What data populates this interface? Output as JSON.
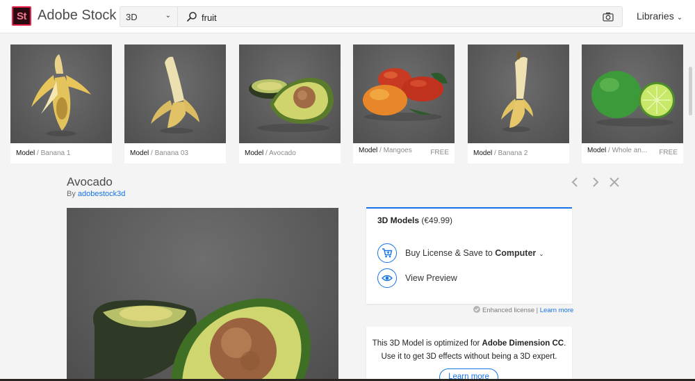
{
  "header": {
    "logo_text": "St",
    "brand": "Adobe Stock",
    "asset_type": "3D",
    "search_query": "fruit",
    "libraries_label": "Libraries"
  },
  "thumbnails": [
    {
      "kind": "Model",
      "sep": " / ",
      "name": "Banana 1",
      "free": "",
      "icon": "banana-peeled-image"
    },
    {
      "kind": "Model",
      "sep": " / ",
      "name": "Banana 03",
      "free": "",
      "icon": "banana-peeled-image"
    },
    {
      "kind": "Model",
      "sep": " / ",
      "name": "Avocado",
      "free": "",
      "icon": "avocado-image"
    },
    {
      "kind": "Model",
      "sep": " / ",
      "name": "Mangoes",
      "free": "FREE",
      "icon": "mangoes-image"
    },
    {
      "kind": "Model",
      "sep": " / ",
      "name": "Banana 2",
      "free": "",
      "icon": "banana-peeled-image"
    },
    {
      "kind": "Model",
      "sep": " / ",
      "name": "Whole an...",
      "free": "FREE",
      "icon": "limes-image"
    }
  ],
  "detail": {
    "title": "Avocado",
    "by_prefix": "By ",
    "author": "adobestock3d",
    "license": {
      "category": "3D Models",
      "price": " (€49.99)",
      "buy_label": "Buy License & Save to ",
      "buy_target": "Computer",
      "preview_label": "View Preview"
    },
    "enhanced_text": "Enhanced license | ",
    "enhanced_link": "Learn more",
    "dimension": {
      "line1_prefix": "This 3D Model is optimized for ",
      "line1_bold": "Adobe Dimension CC",
      "line1_suffix": ".",
      "line2": "Use it to get 3D effects without being a 3D expert.",
      "button": "Learn more"
    }
  },
  "colors": {
    "accent": "#1473e6",
    "logo_bg": "#2b0a12",
    "logo_border": "#e8224d"
  }
}
